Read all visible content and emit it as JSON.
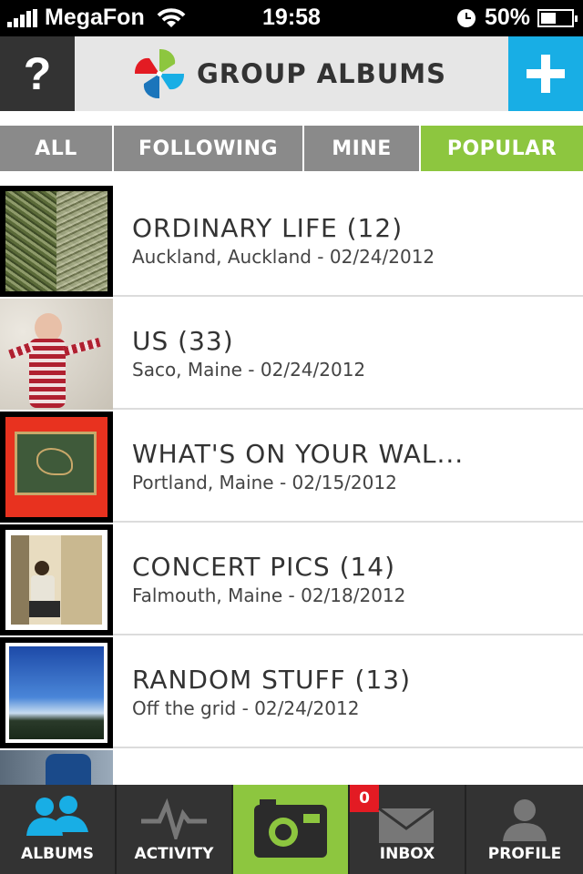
{
  "status_bar": {
    "carrier": "MegaFon",
    "time": "19:58",
    "battery": "50%",
    "battery_level": 0.5
  },
  "header": {
    "help_label": "?",
    "title": "GROUP ALBUMS"
  },
  "tabs": [
    {
      "label": "ALL",
      "active": false
    },
    {
      "label": "FOLLOWING",
      "active": false
    },
    {
      "label": "MINE",
      "active": false
    },
    {
      "label": "POPULAR",
      "active": true
    }
  ],
  "albums": [
    {
      "title": "ORDINARY LIFE (12)",
      "subtitle": "Auckland, Auckland - 02/24/2012"
    },
    {
      "title": "US (33)",
      "subtitle": "Saco, Maine - 02/24/2012"
    },
    {
      "title": "WHAT'S ON YOUR WAL...",
      "subtitle": "Portland, Maine - 02/15/2012"
    },
    {
      "title": "CONCERT PICS (14)",
      "subtitle": "Falmouth, Maine - 02/18/2012"
    },
    {
      "title": "RANDOM STUFF (13)",
      "subtitle": "Off the grid - 02/24/2012"
    }
  ],
  "tab_bar": {
    "albums": "ALBUMS",
    "activity": "ACTIVITY",
    "inbox": "INBOX",
    "inbox_badge": "0",
    "profile": "PROFILE"
  },
  "colors": {
    "accent_green": "#8dc63f",
    "accent_blue": "#18aee5",
    "badge_red": "#e31b23"
  },
  "icons": [
    "signal-icon",
    "wifi-icon",
    "clock-icon",
    "battery-icon",
    "help-icon",
    "pinwheel-logo-icon",
    "plus-icon",
    "albums-people-icon",
    "activity-pulse-icon",
    "camera-icon",
    "inbox-envelope-icon",
    "profile-person-icon"
  ]
}
